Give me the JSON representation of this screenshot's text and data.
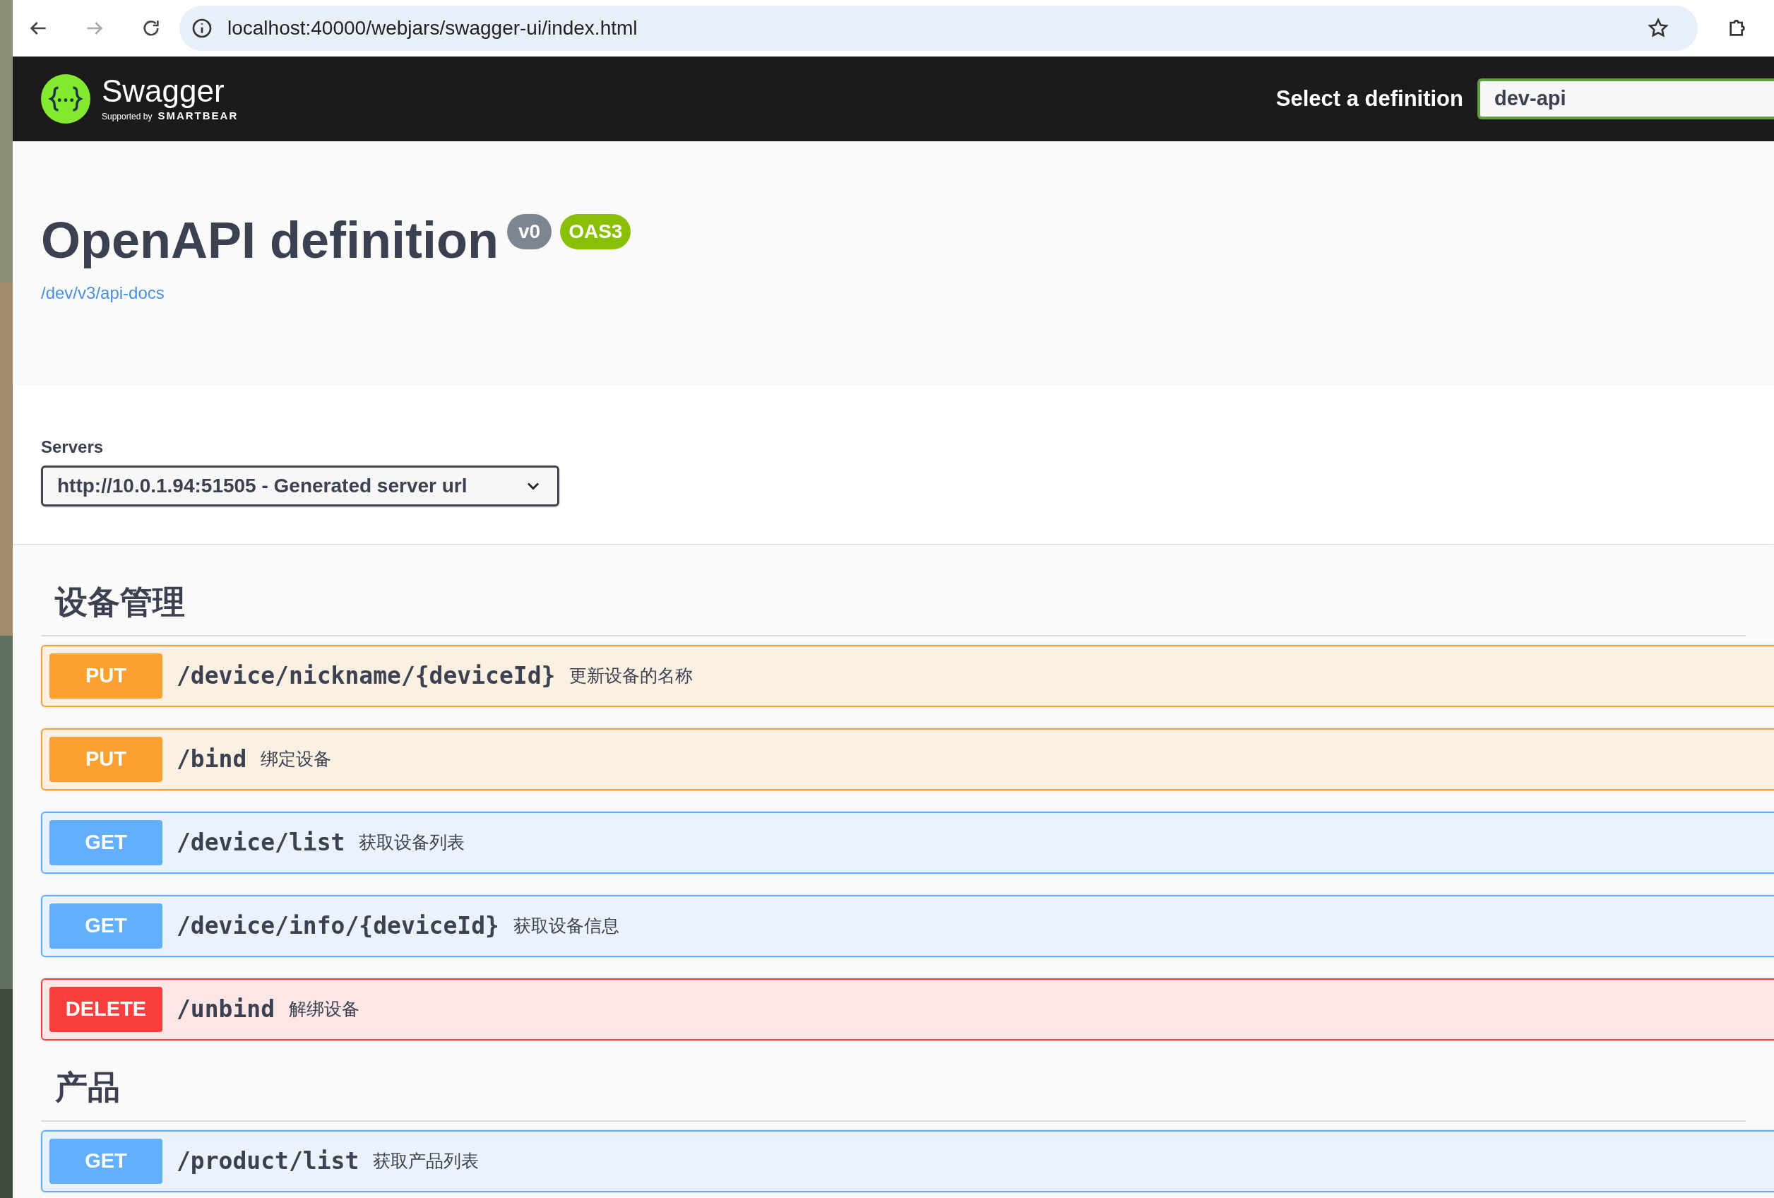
{
  "browser": {
    "url": "localhost:40000/webjars/swagger-ui/index.html"
  },
  "topbar": {
    "logo_text": "Swagger",
    "logo_sub": "Supported by",
    "logo_brand": "SMARTBEAR",
    "select_label": "Select a definition",
    "select_value": "dev-api"
  },
  "info": {
    "title": "OpenAPI definition",
    "version": "v0",
    "spec": "OAS3",
    "link": "/dev/v3/api-docs"
  },
  "servers": {
    "label": "Servers",
    "value": "http://10.0.1.94:51505 - Generated server url"
  },
  "tags": [
    {
      "name": "设备管理",
      "operations": [
        {
          "kind": "put",
          "method": "PUT",
          "path": "/device/nickname/{deviceId}",
          "summary": "更新设备的名称"
        },
        {
          "kind": "put",
          "method": "PUT",
          "path": "/bind",
          "summary": "绑定设备"
        },
        {
          "kind": "get",
          "method": "GET",
          "path": "/device/list",
          "summary": "获取设备列表"
        },
        {
          "kind": "get",
          "method": "GET",
          "path": "/device/info/{deviceId}",
          "summary": "获取设备信息"
        },
        {
          "kind": "delete",
          "method": "DELETE",
          "path": "/unbind",
          "summary": "解绑设备"
        }
      ]
    },
    {
      "name": "产品",
      "operations": [
        {
          "kind": "get",
          "method": "GET",
          "path": "/product/list",
          "summary": "获取产品列表"
        }
      ]
    }
  ]
}
